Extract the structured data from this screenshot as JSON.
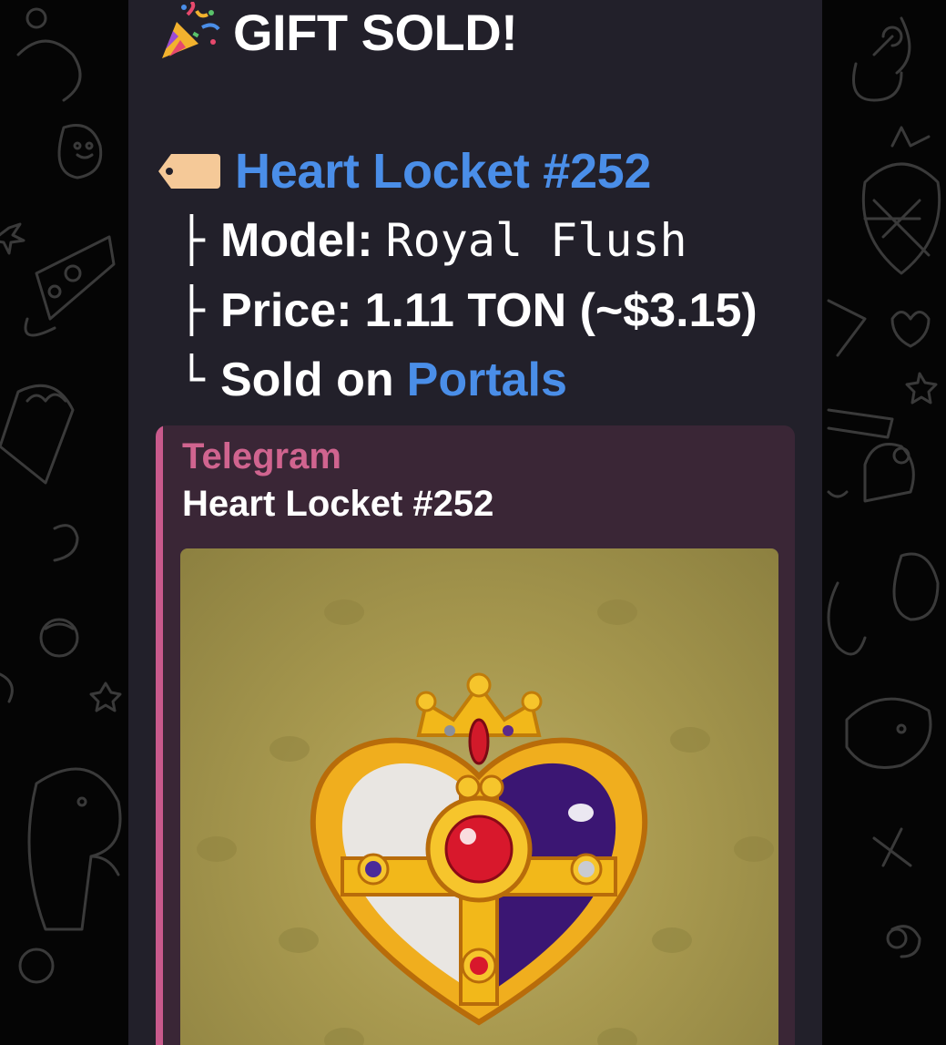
{
  "message": {
    "header": {
      "emoji": "party-popper-icon",
      "text": "GIFT SOLD!"
    },
    "gift": {
      "tag_emoji": "tag-icon",
      "title": "Heart Locket #252"
    },
    "details": [
      {
        "tree": "├",
        "label": "Model:",
        "value": "Royal Flush"
      },
      {
        "tree": "├",
        "label": "Price:",
        "value": "1.11 TON (~$3.15)"
      },
      {
        "tree": "└",
        "label": "Sold on",
        "link": "Portals"
      }
    ],
    "preview": {
      "site_name": "Telegram",
      "title": "Heart Locket #252",
      "image": "heart-locket-image"
    }
  },
  "colors": {
    "bubble": "#22202a",
    "link": "#4a8ee8",
    "preview_accent": "#c95a8c",
    "preview_bg": "#3a2636"
  }
}
